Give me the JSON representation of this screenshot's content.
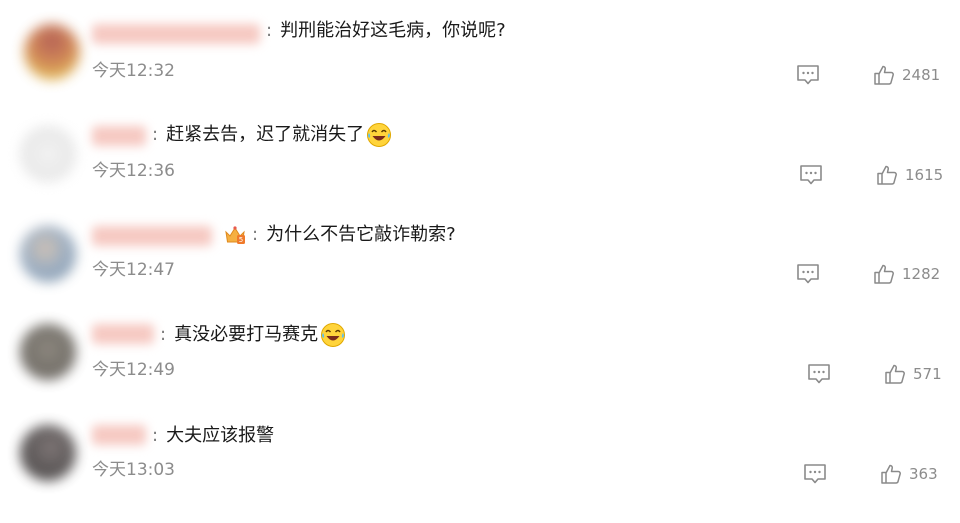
{
  "comments": [
    {
      "avatar_color": "#b2553a",
      "colon": ":",
      "text": "判刑能治好这毛病，你说呢?",
      "emoji": "",
      "time": "今天12:32",
      "likes": "2481",
      "reply_icon": "comment-bubble-icon",
      "like_icon": "thumbs-up-icon"
    },
    {
      "avatar_color": "#e4e4e4",
      "colon": ":",
      "text": "赶紧去告，迟了就消失了",
      "emoji": "laugh-cry-emoji",
      "time": "今天12:36",
      "likes": "1615",
      "reply_icon": "comment-bubble-icon",
      "like_icon": "thumbs-up-icon"
    },
    {
      "avatar_color": "#8aa0b8",
      "colon": ":",
      "text": "为什么不告它敲诈勒索?",
      "emoji": "",
      "badge": "crown-badge-icon",
      "time": "今天12:47",
      "likes": "1282",
      "reply_icon": "comment-bubble-icon",
      "like_icon": "thumbs-up-icon"
    },
    {
      "avatar_color": "#5f5a52",
      "colon": ":",
      "text": "真没必要打马赛克",
      "emoji": "laugh-cry-emoji",
      "time": "今天12:49",
      "likes": "571",
      "reply_icon": "comment-bubble-icon",
      "like_icon": "thumbs-up-icon"
    },
    {
      "avatar_color": "#3f3a3a",
      "colon": ":",
      "text": "大夫应该报警",
      "emoji": "",
      "time": "今天13:03",
      "likes": "363",
      "reply_icon": "comment-bubble-icon",
      "like_icon": "thumbs-up-icon"
    }
  ],
  "colors": {
    "name_blur": "#f6c9c2",
    "muted_text": "#8c8c8c",
    "icon_stroke": "#8a8a8a"
  }
}
